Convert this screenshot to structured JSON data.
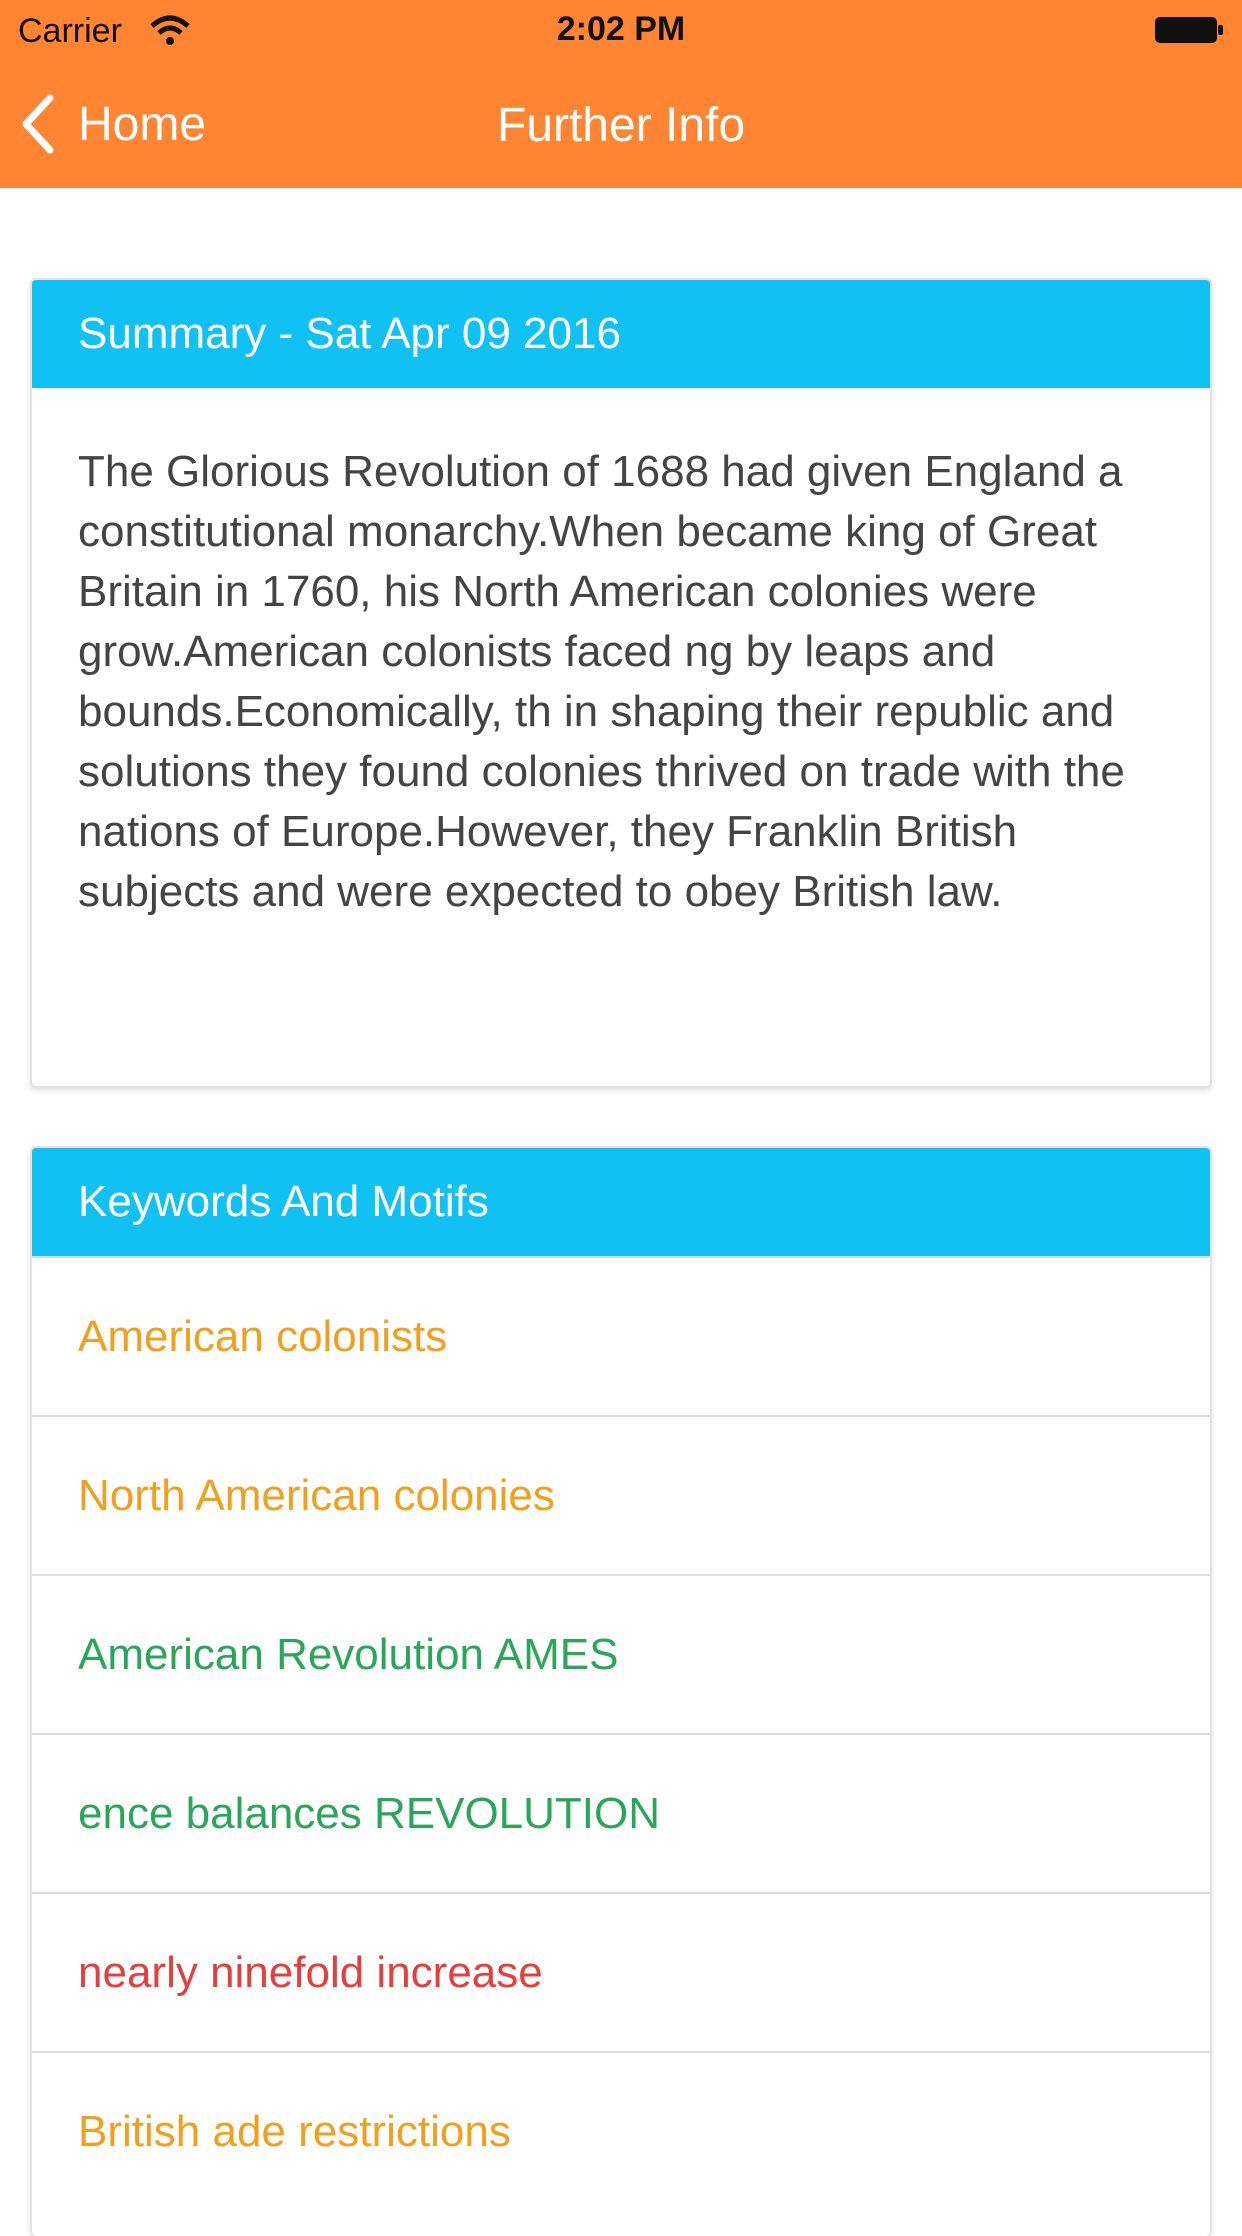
{
  "status_bar": {
    "carrier": "Carrier",
    "time": "2:02 PM"
  },
  "nav": {
    "back_label": "Home",
    "title": "Further Info"
  },
  "summary": {
    "header": "Summary - Sat Apr 09 2016",
    "body": "The Glorious Revolution of 1688 had given England a constitutional monarchy.When became king of Great Britain in 1760, his North American colonies were grow.American colonists faced ng by leaps and bounds.Economically, th in shaping their republic and solutions they found colonies thrived on trade with the nations of Europe.However, they Franklin British subjects and were expected to obey British law."
  },
  "keywords": {
    "header": "Keywords And Motifs",
    "items": [
      {
        "label": "American colonists",
        "color": "#f0a01e"
      },
      {
        "label": "North American colonies",
        "color": "#f0a01e"
      },
      {
        "label": "American Revolution AMES",
        "color": "#2aa65a"
      },
      {
        "label": "ence balances REVOLUTION",
        "color": "#2aa65a"
      },
      {
        "label": "nearly ninefold increase",
        "color": "#e53e3e"
      },
      {
        "label": "British ade restrictions",
        "color": "#f0a01e"
      }
    ]
  },
  "colors": {
    "nav_bg": "#ff8533",
    "header_bg": "#11c1f3"
  }
}
